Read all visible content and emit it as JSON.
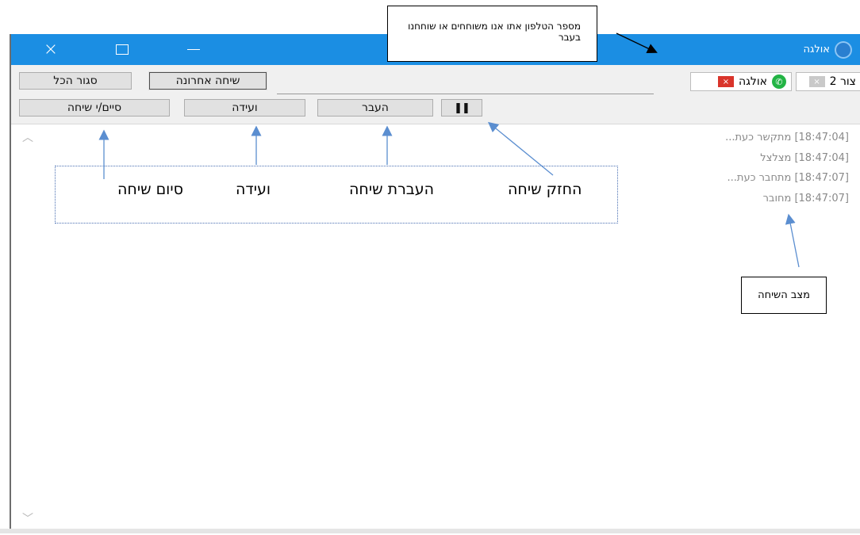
{
  "window": {
    "title": "אולגה",
    "close_icon": "×"
  },
  "tabs": [
    {
      "label": "צור 2",
      "close": "×",
      "icon": "close-icon"
    },
    {
      "label": "אולגה",
      "close": "×",
      "icon": "whatsapp-icon"
    }
  ],
  "tab_actions": {
    "close_all": "סגור הכל",
    "last_call": "שיחה אחרונה"
  },
  "toolbar": {
    "end_call": "סיים/י שיחה",
    "conference": "ועידה",
    "transfer": "העבר",
    "hold_icon": "❚❚"
  },
  "log": [
    {
      "time": "[18:47:04]",
      "text": "מתקשר כעת..."
    },
    {
      "time": "[18:47:04]",
      "text": "מצלצל"
    },
    {
      "time": "[18:47:07]",
      "text": "מתחבר כעת..."
    },
    {
      "time": "[18:47:07]",
      "text": "מחובר"
    }
  ],
  "annotations": {
    "phone_callout": "מספר הטלפון אתו אנו משוחחים או שוחחנו בעבר",
    "hold": "החזק שיחה",
    "transfer": "העברת שיחה",
    "conference": "ועידה",
    "end": "סיום שיחה",
    "status": "מצב השיחה"
  },
  "colors": {
    "titlebar": "#1b8ee3",
    "arrow": "#5b8ed0",
    "tab_close_active": "#d9342b"
  }
}
